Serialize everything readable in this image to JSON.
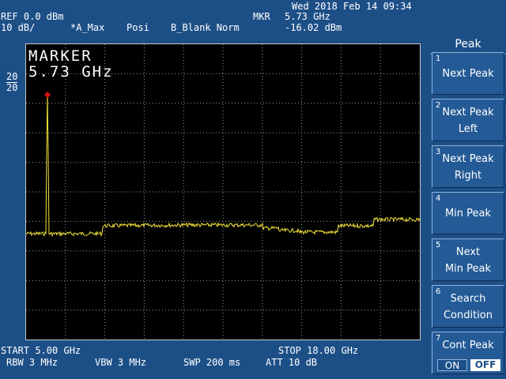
{
  "header": {
    "datetime": "Wed 2018 Feb 14 09:34",
    "ref": "REF 0.0 dBm",
    "scale": "10 dB/",
    "trace_mode": "*A_Max",
    "detector": "Posi",
    "trace_b": "B_Blank Norm",
    "mkr_label": "MKR",
    "mkr_freq": "5.73 GHz",
    "mkr_level": "-16.02 dBm"
  },
  "display": {
    "marker_title": "MARKER",
    "marker_value": "5.73 GHz",
    "scale_top": "20",
    "scale_bottom": "20",
    "trace_color": "#f2e23a",
    "marker_color": "#e01010"
  },
  "softkeys": {
    "title": "Peak",
    "items": [
      {
        "num": "1",
        "line1": "Next Peak",
        "line2": ""
      },
      {
        "num": "2",
        "line1": "Next Peak",
        "line2": "Left"
      },
      {
        "num": "3",
        "line1": "Next Peak",
        "line2": "Right"
      },
      {
        "num": "4",
        "line1": "Min Peak",
        "line2": ""
      },
      {
        "num": "5",
        "line1": "Next",
        "line2": "Min Peak"
      },
      {
        "num": "6",
        "line1": "Search",
        "line2": "Condition"
      },
      {
        "num": "7",
        "line1": "Cont Peak",
        "line2": "",
        "on": "ON",
        "off": "OFF"
      }
    ]
  },
  "footer": {
    "start": "START 5.00 GHz",
    "stop": "STOP 18.00 GHz",
    "rbw": "RBW 3 MHz",
    "vbw": "VBW 3 MHz",
    "swp": "SWP 200 ms",
    "att": "ATT 10 dB"
  }
}
